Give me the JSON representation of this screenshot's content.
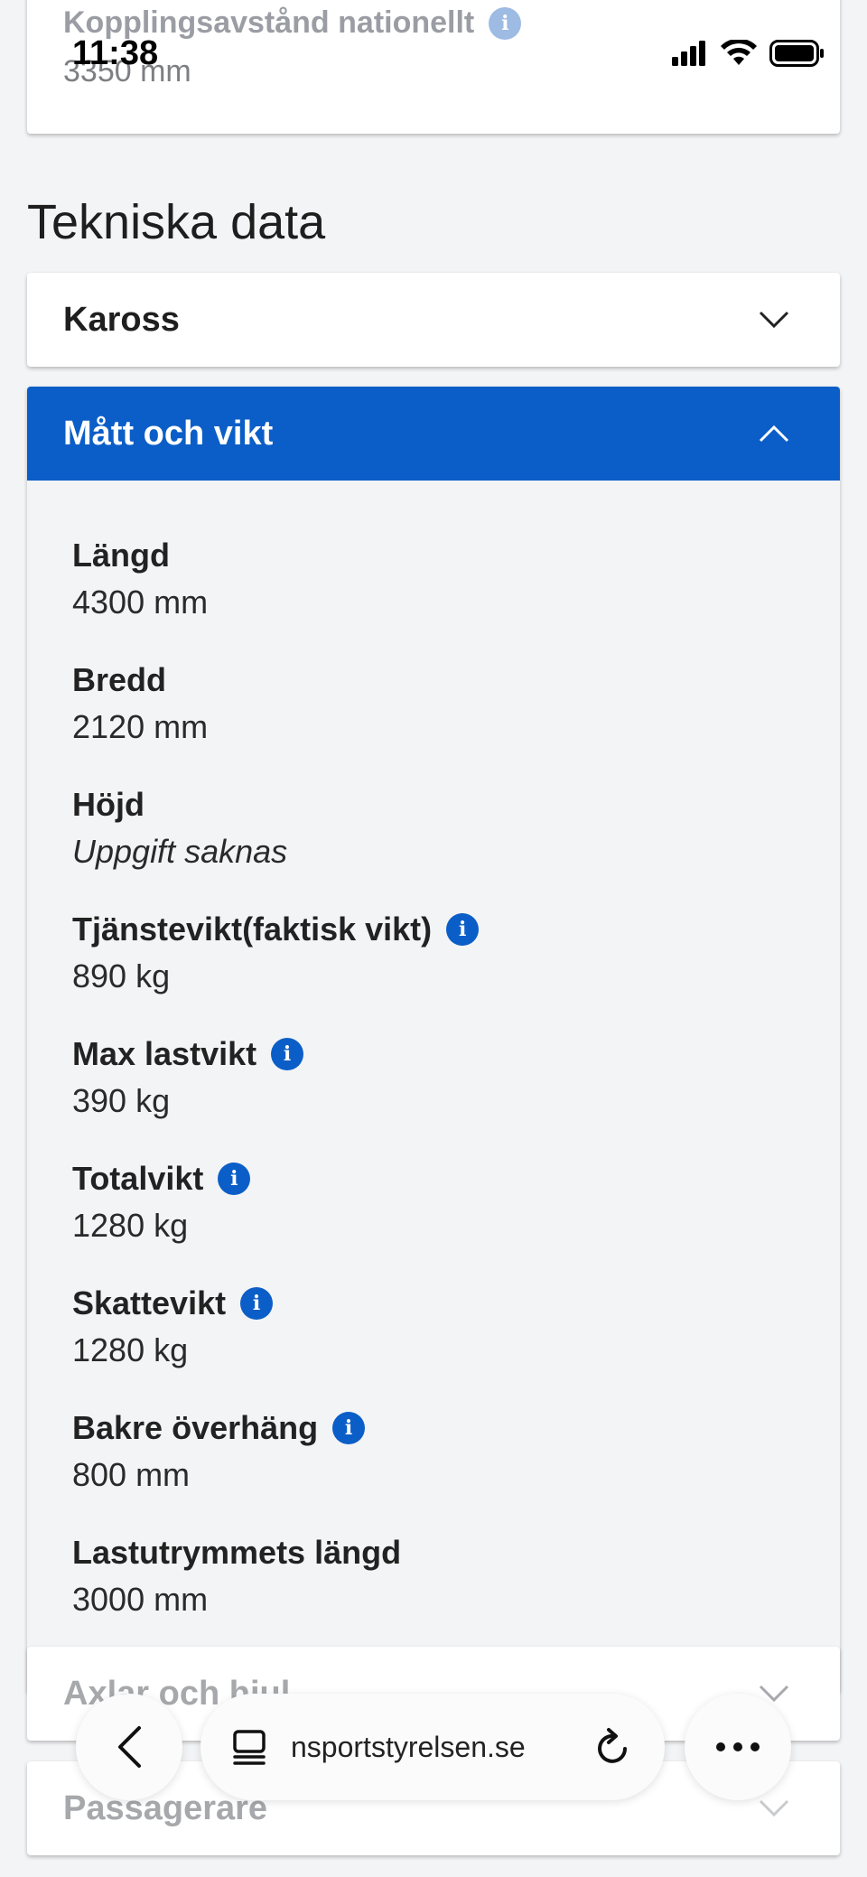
{
  "status_bar": {
    "time": "11:38"
  },
  "top_card": {
    "label": "Kopplingsavstånd nationellt",
    "value": "3350 mm"
  },
  "section_title": "Tekniska data",
  "accordions": {
    "kaross": {
      "title": "Kaross"
    },
    "matt_och_vikt": {
      "title": "Mått och vikt",
      "fields": [
        {
          "label": "Längd",
          "value": "4300 mm",
          "info": false
        },
        {
          "label": "Bredd",
          "value": "2120 mm",
          "info": false
        },
        {
          "label": "Höjd",
          "value": "Uppgift saknas",
          "info": false
        },
        {
          "label": "Tjänstevikt(faktisk vikt)",
          "value": "890 kg",
          "info": true
        },
        {
          "label": "Max lastvikt",
          "value": "390 kg",
          "info": true
        },
        {
          "label": "Totalvikt",
          "value": "1280 kg",
          "info": true
        },
        {
          "label": "Skattevikt",
          "value": "1280 kg",
          "info": true
        },
        {
          "label": "Bakre överhäng",
          "value": "800 mm",
          "info": true
        },
        {
          "label": "Lastutrymmets längd",
          "value": "3000 mm",
          "info": false
        }
      ]
    },
    "axlar_och_hjul": {
      "title": "Axlar och hjul"
    },
    "passagerare": {
      "title": "Passagerare"
    }
  },
  "browser": {
    "url": "nsportstyrelsen.se"
  },
  "colors": {
    "accent": "#0b5ec7",
    "background": "#f3f4f6"
  }
}
